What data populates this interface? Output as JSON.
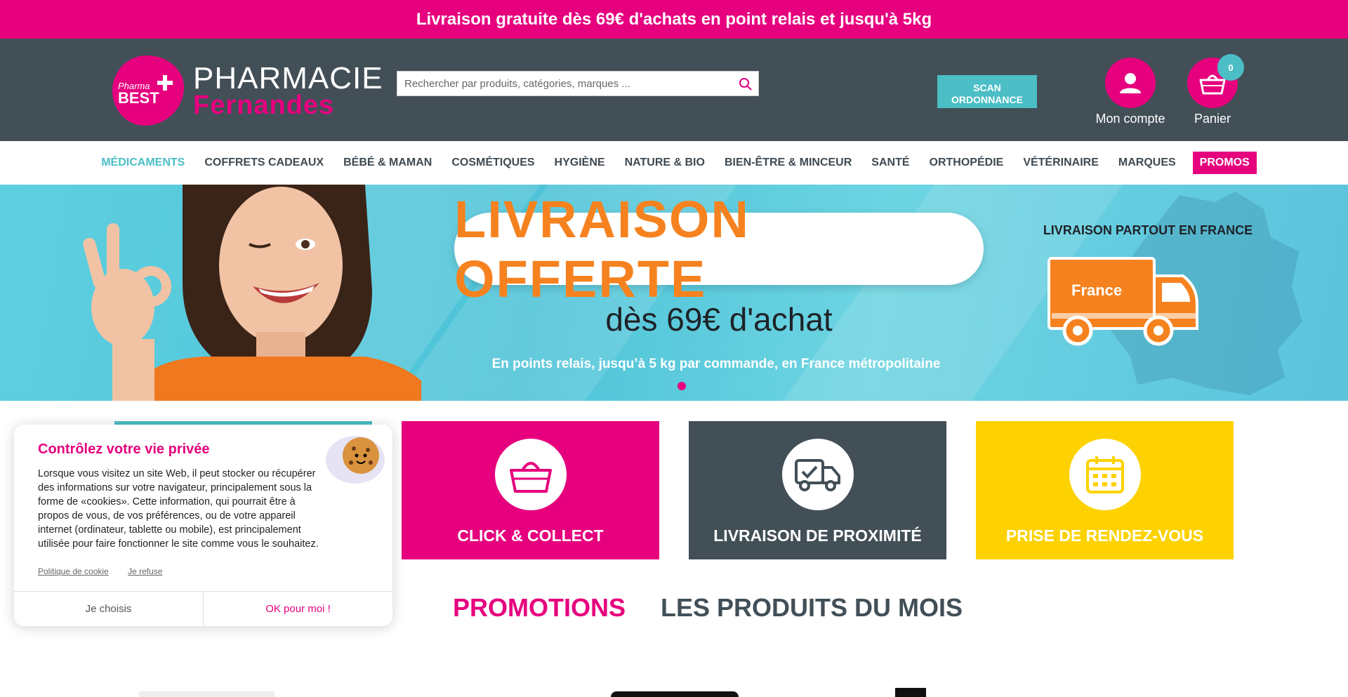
{
  "topbar": {
    "text": "Livraison gratuite dès 69€ d'achats en point relais et jusqu'à 5kg"
  },
  "header": {
    "logo_badge_1": "Pharma",
    "logo_badge_2": "BEST",
    "logo_name_1": "PHARMACIE",
    "logo_name_2": "Fernandes",
    "search_placeholder": "Rechercher par produits, catégories, marques ...",
    "scan_button": "SCAN ORDONNANCE",
    "account_label": "Mon compte",
    "cart_label": "Panier",
    "cart_count": "0"
  },
  "nav": {
    "items": [
      "MÉDICAMENTS",
      "COFFRETS CADEAUX",
      "BÉBÉ & MAMAN",
      "COSMÉTIQUES",
      "HYGIÈNE",
      "NATURE & BIO",
      "BIEN-ÊTRE & MINCEUR",
      "SANTÉ",
      "ORTHOPÉDIE",
      "VÉTÉRINAIRE",
      "MARQUES",
      "PROMOS"
    ]
  },
  "hero": {
    "headline": "LIVRAISON OFFERTE",
    "subline": "dès 69€ d'achat",
    "note": "En points relais, jusqu’à 5 kg par commande, en France métropolitaine",
    "right_title": "LIVRAISON PARTOUT EN FRANCE",
    "truck_label": "France"
  },
  "services": [
    {
      "label": "CLICK & COLLECT",
      "icon": "shopping-basket-icon",
      "color": "#e6007e"
    },
    {
      "label": "LIVRAISON DE PROXIMITÉ",
      "icon": "delivery-truck-icon",
      "color": "#424f57"
    },
    {
      "label": "PRISE DE RENDEZ-VOUS",
      "icon": "calendar-icon",
      "color": "#fdd200"
    }
  ],
  "product_tabs": {
    "promotions": "PROMOTIONS",
    "month": "LES PRODUITS DU MOIS"
  },
  "cookie": {
    "title": "Contrôlez votre vie privée",
    "text": "Lorsque vous visitez un site Web, il peut stocker ou récupérer des informations sur votre navigateur, principalement sous la forme de «cookies». Cette information, qui pourrait être à propos de vous, de vos préférences, ou de votre appareil internet (ordinateur, tablette ou mobile), est principalement utilisée pour faire fonctionner le site comme vous le souhaitez.",
    "policy_link": "Politique de cookie",
    "refuse_link": "Je refuse",
    "choose_button": "Je choisis",
    "ok_button": "OK pour moi !"
  },
  "colors": {
    "brand_pink": "#e6007e",
    "header_dark": "#424f57",
    "accent_teal": "#4bbec6",
    "hero_orange": "#f6821f",
    "tile_yellow": "#fdd200"
  }
}
